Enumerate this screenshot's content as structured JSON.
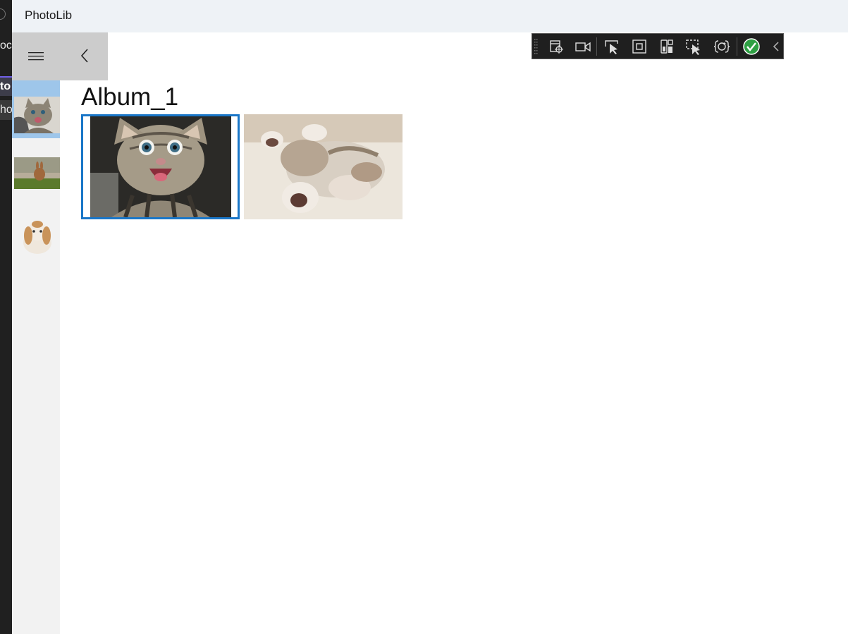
{
  "background": {
    "texts": [
      "oc",
      "to",
      "ho"
    ]
  },
  "app": {
    "title": "PhotoLib"
  },
  "nav": {
    "hamburger_icon": "hamburger-icon",
    "back_icon": "back-icon"
  },
  "pane": {
    "items": [
      {
        "name": "kitten",
        "selected": true
      },
      {
        "name": "rabbit-on-grass",
        "selected": false
      },
      {
        "name": "lop-rabbit",
        "selected": false
      }
    ]
  },
  "album": {
    "title": "Album_1",
    "photos": [
      {
        "subject": "laughing-kitten",
        "selected": true
      },
      {
        "subject": "sleeping-kitten",
        "selected": false
      }
    ]
  },
  "debug_toolbar": {
    "buttons": [
      "select-element-icon",
      "record-icon",
      "select-in-running-app-icon",
      "display-layout-adorners-icon",
      "track-focus-icon",
      "select-accessibility-icon",
      "hot-reload-icon",
      "binding-failures-ok-icon",
      "collapse-icon"
    ]
  },
  "colors": {
    "titlebar": "#eef2f6",
    "nav_bg": "#cccccc",
    "pane_bg": "#f2f2f2",
    "pane_selected": "#9ec6ea",
    "selection_border": "#1976c8",
    "toolbar_bg": "#1f1f1f",
    "status_ok": "#2ea043"
  }
}
